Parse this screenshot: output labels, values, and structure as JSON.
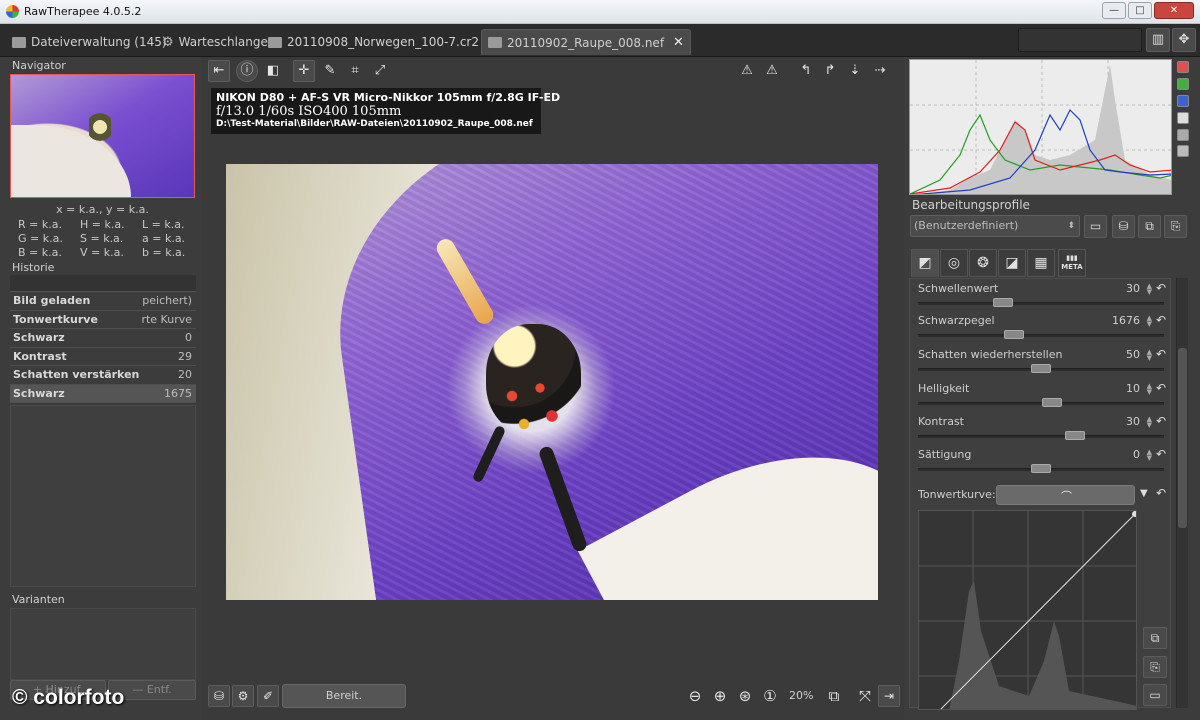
{
  "window": {
    "title": "RawTherapee 4.0.5.2"
  },
  "tabs": [
    {
      "label": "Dateiverwaltung (145)"
    },
    {
      "label": "Warteschlange"
    },
    {
      "label": "20110908_Norwegen_100-7.cr2"
    },
    {
      "label": "20110902_Raupe_008.nef"
    }
  ],
  "navigator": {
    "title": "Navigator",
    "coords": "x = k.a., y = k.a.",
    "pixinfo": [
      "R = k.a.",
      "H = k.a.",
      "L = k.a.",
      "G = k.a.",
      "S = k.a.",
      "a = k.a.",
      "B = k.a.",
      "V = k.a.",
      "b = k.a."
    ]
  },
  "history": {
    "title": "Historie",
    "rows": [
      {
        "name": "Bild geladen",
        "value": "peichert)"
      },
      {
        "name": "Tonwertkurve",
        "value": "rte Kurve"
      },
      {
        "name": "Schwarz",
        "value": "0"
      },
      {
        "name": "Kontrast",
        "value": "29"
      },
      {
        "name": "Schatten verstärken",
        "value": "20"
      },
      {
        "name": "Schwarz",
        "value": "1675"
      }
    ]
  },
  "variants": {
    "title": "Varianten",
    "add_label": "Hinzuf.",
    "remove_label": "Entf."
  },
  "watermark": "© colorfoto",
  "exif": {
    "line1": "NIKON D80 + AF-S VR Micro-Nikkor 105mm f/2.8G IF-ED",
    "line2": "f/13.0  1/60s  ISO400  105mm",
    "line3": "D:\\Test-Material\\Bilder\\RAW-Dateien\\20110902_Raupe_008.nef"
  },
  "status": {
    "text": "Bereit.",
    "zoom": "20%"
  },
  "profiles": {
    "title": "Bearbeitungsprofile",
    "selected": "(Benutzerdefiniert)"
  },
  "tooltabs": {
    "meta_label": "META"
  },
  "adjustments": [
    {
      "label": "Schwellenwert",
      "value": "30",
      "thumb": 0.33
    },
    {
      "label": "Schwarzpegel",
      "value": "1676",
      "thumb": 0.38
    },
    {
      "label": "Schatten wiederherstellen",
      "value": "50",
      "thumb": 0.5
    },
    {
      "label": "Helligkeit",
      "value": "10",
      "thumb": 0.55
    },
    {
      "label": "Kontrast",
      "value": "30",
      "thumb": 0.65
    },
    {
      "label": "Sättigung",
      "value": "0",
      "thumb": 0.5
    }
  ],
  "tone_curve": {
    "label": "Tonwertkurve:"
  },
  "colors": {
    "histo_red": "#e02020",
    "histo_green": "#20a020",
    "histo_blue": "#2040c0",
    "accent_red": "#e05050"
  }
}
